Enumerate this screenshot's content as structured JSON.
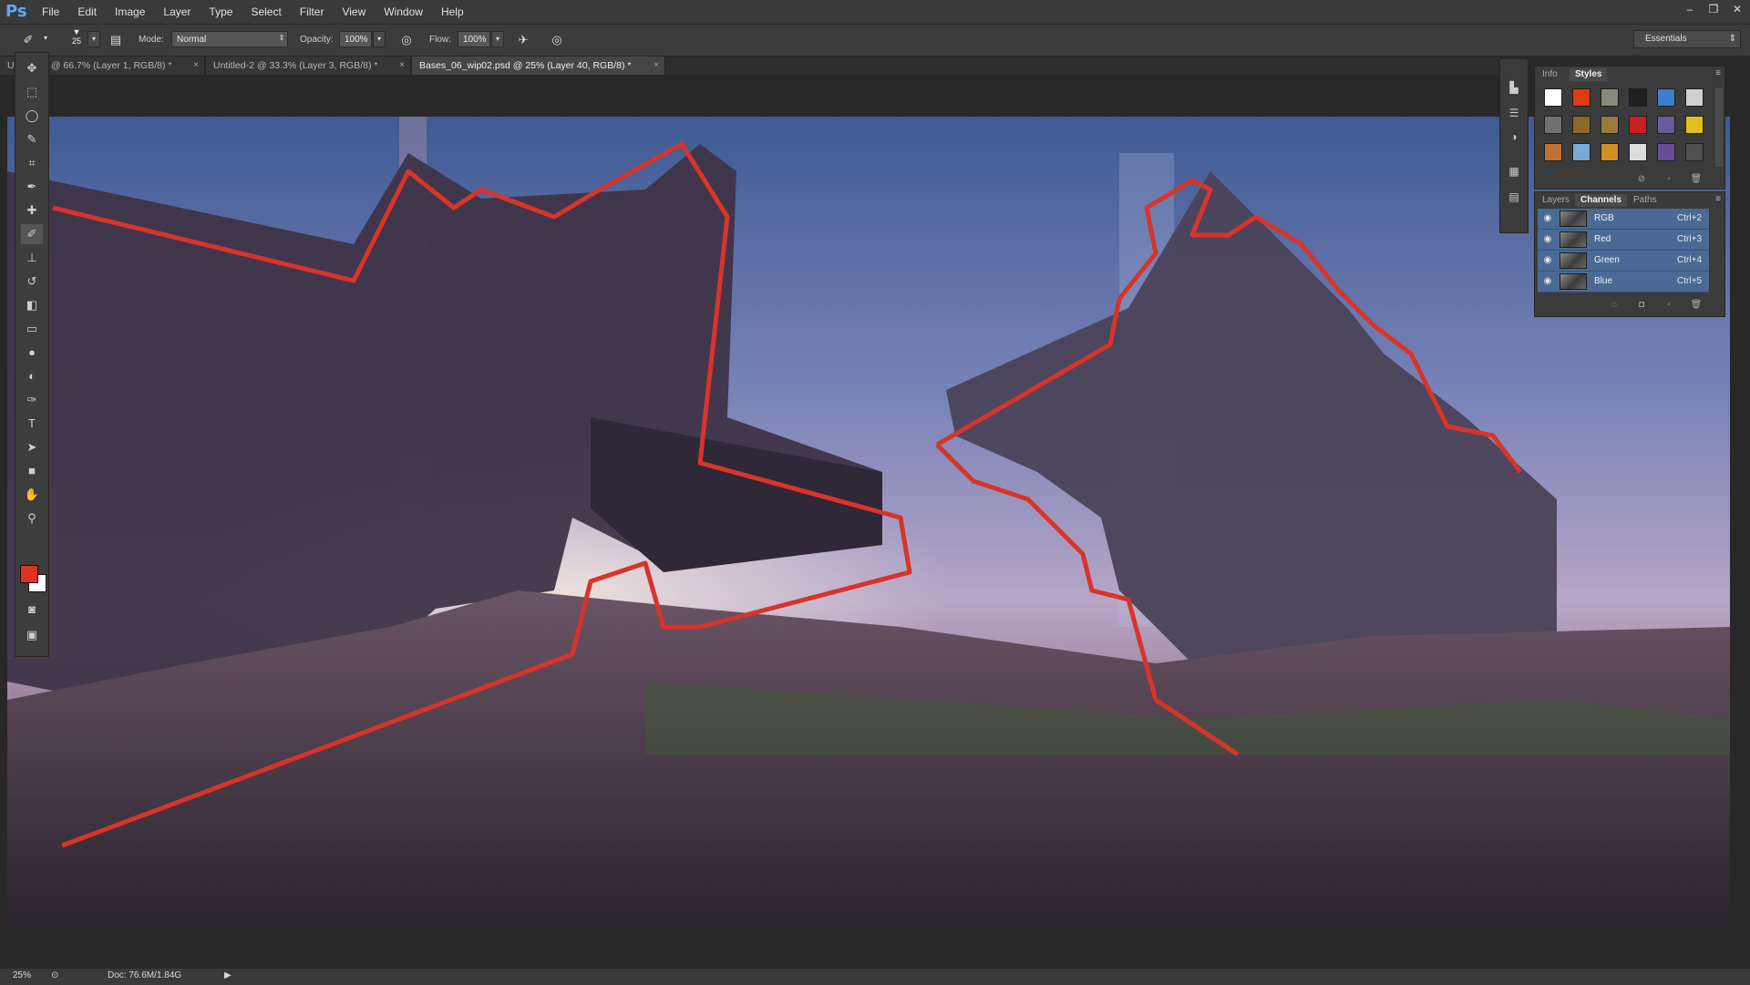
{
  "app": {
    "logo": "Ps"
  },
  "menu": [
    "File",
    "Edit",
    "Image",
    "Layer",
    "Type",
    "Select",
    "Filter",
    "View",
    "Window",
    "Help"
  ],
  "window_controls": {
    "minimize": "–",
    "restore": "❐",
    "close": "✕"
  },
  "options": {
    "brush_size": "25",
    "mode_label": "Mode:",
    "mode_value": "Normal",
    "opacity_label": "Opacity:",
    "opacity_value": "100%",
    "flow_label": "Flow:",
    "flow_value": "100%",
    "workspace": "Essentials"
  },
  "tabs": [
    {
      "label": "Untitled-1 @ 66.7% (Layer 1, RGB/8) *",
      "active": false
    },
    {
      "label": "Untitled-2 @ 33.3% (Layer 3, RGB/8) *",
      "active": false
    },
    {
      "label": "Bases_06_wip02.psd @ 25% (Layer 40, RGB/8) *",
      "active": true
    }
  ],
  "tab_close": "×",
  "tools": [
    {
      "name": "move-tool-icon",
      "glyph": "✥"
    },
    {
      "name": "marquee-tool-icon",
      "glyph": "⬚"
    },
    {
      "name": "lasso-tool-icon",
      "glyph": "◯"
    },
    {
      "name": "quick-select-tool-icon",
      "glyph": "✎"
    },
    {
      "name": "crop-tool-icon",
      "glyph": "⌗"
    },
    {
      "name": "eyedropper-tool-icon",
      "glyph": "✒"
    },
    {
      "name": "healing-brush-tool-icon",
      "glyph": "✚"
    },
    {
      "name": "brush-tool-icon",
      "glyph": "✐"
    },
    {
      "name": "clone-stamp-tool-icon",
      "glyph": "⊥"
    },
    {
      "name": "history-brush-tool-icon",
      "glyph": "↺"
    },
    {
      "name": "eraser-tool-icon",
      "glyph": "◧"
    },
    {
      "name": "gradient-tool-icon",
      "glyph": "▭"
    },
    {
      "name": "blur-tool-icon",
      "glyph": "●"
    },
    {
      "name": "dodge-tool-icon",
      "glyph": "◐"
    },
    {
      "name": "pen-tool-icon",
      "glyph": "✑"
    },
    {
      "name": "type-tool-icon",
      "glyph": "T"
    },
    {
      "name": "path-select-tool-icon",
      "glyph": "➤"
    },
    {
      "name": "shape-tool-icon",
      "glyph": "■"
    },
    {
      "name": "hand-tool-icon",
      "glyph": "✋"
    },
    {
      "name": "zoom-tool-icon",
      "glyph": "⚲"
    }
  ],
  "colors": {
    "foreground": "#e0321e",
    "background": "#ffffff",
    "accent": "#4a6a95"
  },
  "styles_panel": {
    "tabs": [
      "Info",
      "Styles"
    ],
    "active_tab": "Styles",
    "swatches": [
      "#ffffff",
      "#e03a10",
      "#8a8a7a",
      "#202020",
      "#3a7fc8",
      "#d0d0d0",
      "#707070",
      "#8a6a2a",
      "#9a7a3a",
      "#c82020",
      "#6a5a9a",
      "#e0c020",
      "#c07030",
      "#7aa8d8",
      "#d09020",
      "#dcdcdc",
      "#6a4a9a",
      "#505050"
    ]
  },
  "channels_panel": {
    "tabs": [
      "Layers",
      "Channels",
      "Paths"
    ],
    "active_tab": "Channels",
    "channels": [
      {
        "name": "RGB",
        "shortcut": "Ctrl+2"
      },
      {
        "name": "Red",
        "shortcut": "Ctrl+3"
      },
      {
        "name": "Green",
        "shortcut": "Ctrl+4"
      },
      {
        "name": "Blue",
        "shortcut": "Ctrl+5"
      }
    ]
  },
  "status": {
    "zoom": "25%",
    "doc": "Doc: 76.6M/1.84G"
  }
}
